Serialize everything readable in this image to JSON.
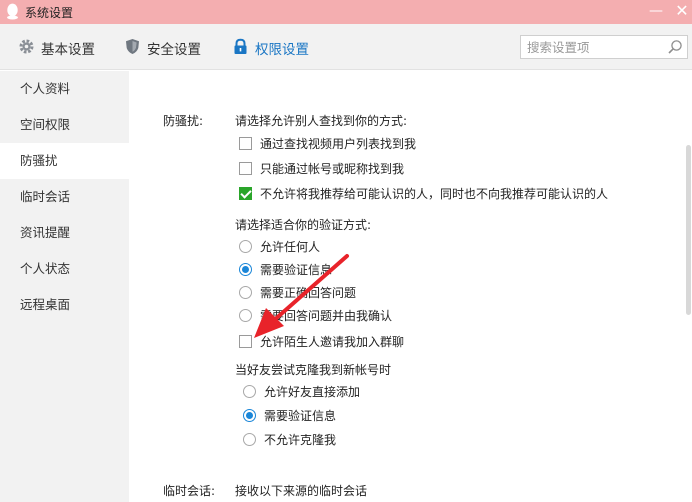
{
  "window": {
    "title": "系统设置",
    "minimize_glyph": "—",
    "close_glyph": "✕"
  },
  "toolbar": {
    "tabs": [
      {
        "label": "基本设置",
        "icon": "gear-icon",
        "active": false
      },
      {
        "label": "安全设置",
        "icon": "shield-icon",
        "active": false
      },
      {
        "label": "权限设置",
        "icon": "lock-icon",
        "active": true
      }
    ],
    "search_placeholder": "搜索设置项",
    "active_color": "#1a76c4"
  },
  "sidebar": {
    "items": [
      {
        "label": "个人资料",
        "active": false
      },
      {
        "label": "空间权限",
        "active": false
      },
      {
        "label": "防骚扰",
        "active": true
      },
      {
        "label": "临时会话",
        "active": false
      },
      {
        "label": "资讯提醒",
        "active": false
      },
      {
        "label": "个人状态",
        "active": false
      },
      {
        "label": "远程桌面",
        "active": false
      }
    ]
  },
  "anti_harass": {
    "section_label": "防骚扰:",
    "find_prompt": "请选择允许别人查找到你的方式:",
    "find_options": [
      {
        "label": "通过查找视频用户列表找到我",
        "checked": false
      },
      {
        "label": "只能通过帐号或昵称找到我",
        "checked": false
      },
      {
        "label": "不允许将我推荐给可能认识的人，同时也不向我推荐可能认识的人",
        "checked": true
      }
    ],
    "verify_prompt": "请选择适合你的验证方式:",
    "verify_options": [
      {
        "label": "允许任何人",
        "checked": false
      },
      {
        "label": "需要验证信息",
        "checked": true
      },
      {
        "label": "需要正确回答问题",
        "checked": false
      },
      {
        "label": "需要回答问题并由我确认",
        "checked": false
      }
    ],
    "group_invite": {
      "label": "允许陌生人邀请我加入群聊",
      "checked": false
    },
    "clone_prompt": "当好友尝试克隆我到新帐号时",
    "clone_options": [
      {
        "label": "允许好友直接添加",
        "checked": false
      },
      {
        "label": "需要验证信息",
        "checked": true
      },
      {
        "label": "不允许克隆我",
        "checked": false
      }
    ]
  },
  "temp_chat": {
    "section_label": "临时会话:",
    "prompt": "接收以下来源的临时会话"
  },
  "colors": {
    "titlebar": "#f4aeb0",
    "checkbox_checked": "#2aa52a",
    "radio_checked": "#1a86d8",
    "annotation_arrow": "#e8232a"
  }
}
